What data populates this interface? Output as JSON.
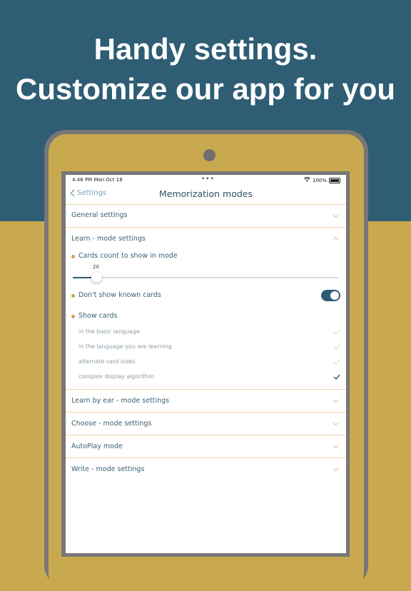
{
  "headline": {
    "line1": "Handy settings.",
    "line2": "Customize our app for you"
  },
  "status_bar": {
    "time": "4:46 PM  Mon Oct 18",
    "dots": "•••",
    "battery_text": "100%",
    "wifi_icon": "wifi-icon",
    "battery_icon": "battery-icon"
  },
  "nav": {
    "back_label": "Settings",
    "title": "Memorization modes"
  },
  "sections": {
    "general": {
      "title": "General settings",
      "expanded": false
    },
    "learn": {
      "title": "Learn - mode settings",
      "expanded": true,
      "cards_count_label": "Cards count to show in mode",
      "cards_count_value": "20",
      "slider_fraction": 0.09,
      "dont_show_known_label": "Don't show known cards",
      "dont_show_known_on": true,
      "show_cards_label": "Show cards",
      "show_cards_options": [
        {
          "label": "in the basic language",
          "checked": false
        },
        {
          "label": "in the language you are learning",
          "checked": false
        },
        {
          "label": "alternate card sides",
          "checked": false
        },
        {
          "label": "complex display algorithm",
          "checked": true
        }
      ]
    },
    "learn_by_ear": {
      "title": "Learn by ear - mode settings",
      "expanded": false
    },
    "choose": {
      "title": "Choose - mode settings",
      "expanded": false
    },
    "autoplay": {
      "title": "AutoPlay mode",
      "expanded": false
    },
    "write": {
      "title": "Write - mode settings",
      "expanded": false
    }
  },
  "colors": {
    "top_background": "#2e5d74",
    "bottom_background": "#c9a94f",
    "accent": "#2e5d74",
    "chevron": "#e8c48a",
    "bullet": "#c9a24d"
  }
}
